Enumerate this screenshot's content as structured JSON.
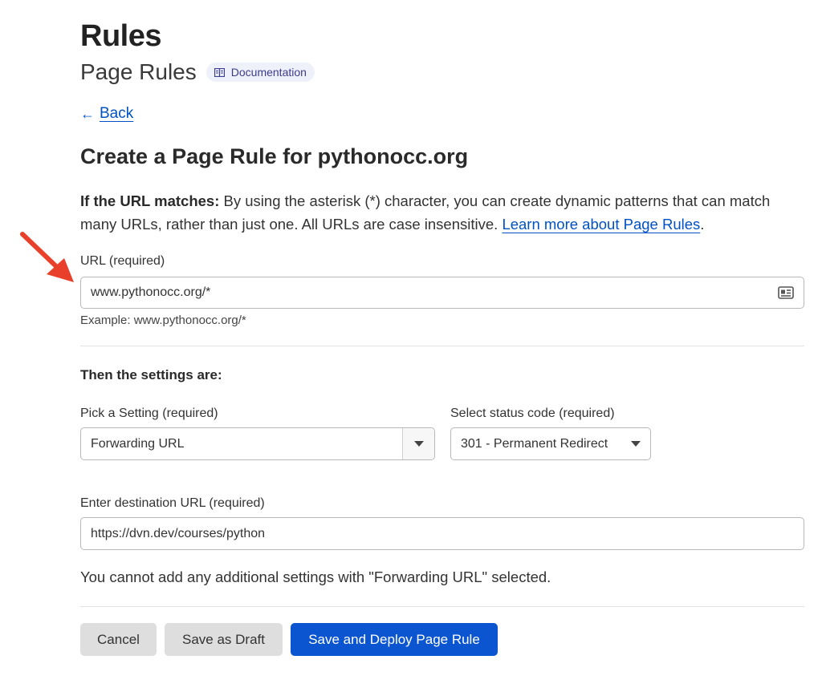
{
  "header": {
    "title": "Rules",
    "subtitle": "Page Rules",
    "doc_badge": "Documentation"
  },
  "nav": {
    "back_label": "Back",
    "back_arrow": "←"
  },
  "form": {
    "heading": "Create a Page Rule for pythonocc.org",
    "intro_bold": "If the URL matches:",
    "intro_text": " By using the asterisk (*) character, you can create dynamic patterns that can match many URLs, rather than just one. All URLs are case insensitive. ",
    "intro_link": "Learn more about Page Rules",
    "intro_end": ".",
    "url_label": "URL (required)",
    "url_value": "www.pythonocc.org/*",
    "url_example": "Example: www.pythonocc.org/*",
    "settings_heading": "Then the settings are:",
    "setting_label": "Pick a Setting (required)",
    "setting_value": "Forwarding URL",
    "status_label": "Select status code (required)",
    "status_value": "301 - Permanent Redirect",
    "dest_label": "Enter destination URL (required)",
    "dest_value": "https://dvn.dev/courses/python",
    "note": "You cannot add any additional settings with \"Forwarding URL\" selected."
  },
  "actions": {
    "cancel": "Cancel",
    "draft": "Save as Draft",
    "deploy": "Save and Deploy Page Rule"
  },
  "colors": {
    "link": "#0051c3",
    "primary": "#0b55d0",
    "annotation_arrow": "#e8402a"
  },
  "icons": [
    "book-icon",
    "contact-card-icon",
    "caret-down-icon",
    "red-pointer-arrow"
  ]
}
